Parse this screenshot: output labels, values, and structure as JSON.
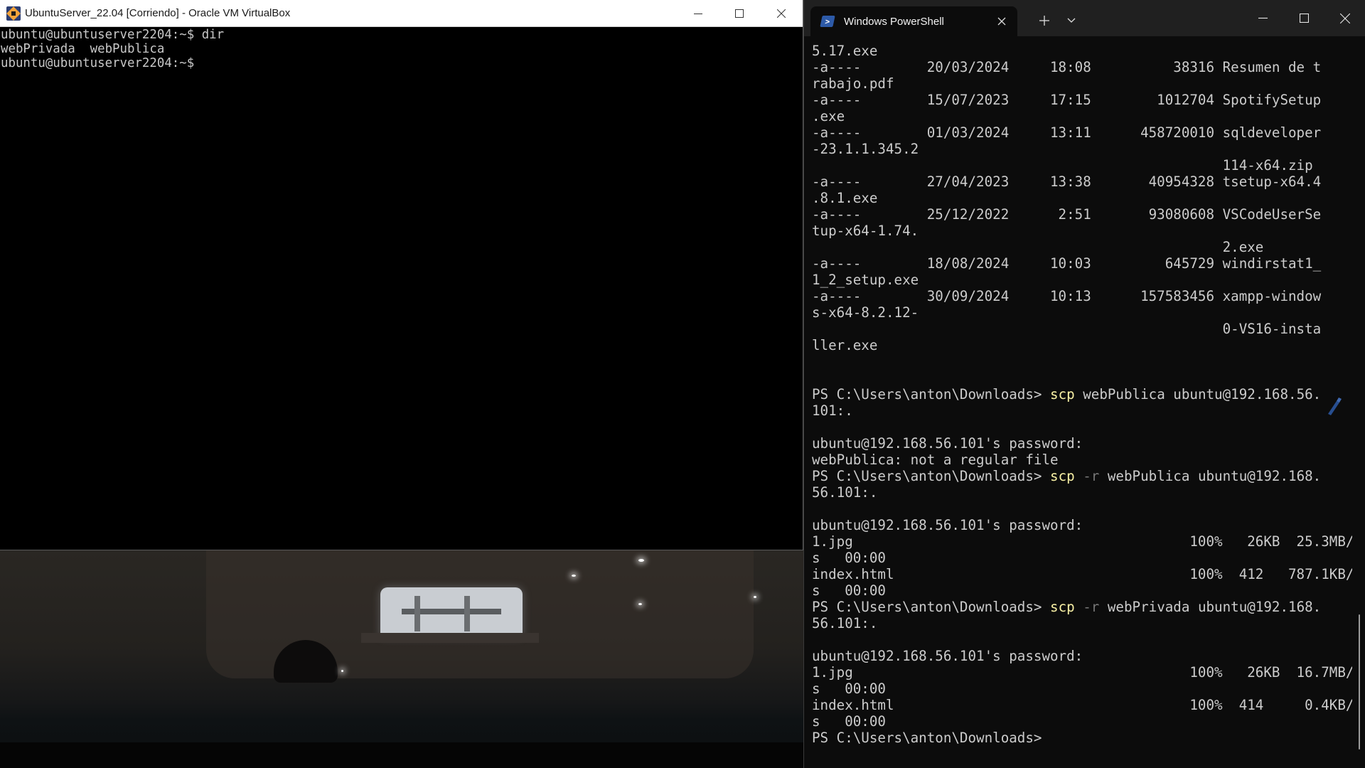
{
  "vbox": {
    "title": "UbuntuServer_22.04 [Corriendo] - Oracle VM VirtualBox",
    "icon": "virtualbox-icon",
    "console_lines": [
      "ubuntu@ubuntuserver2204:~$ dir",
      "webPrivada  webPublica",
      "ubuntu@ubuntuserver2204:~$"
    ]
  },
  "powershell": {
    "tab_title": "Windows PowerShell",
    "tab_icon": "powershell-icon",
    "prompt": "PS C:\\Users\\anton\\Downloads> ",
    "listing_lines": [
      "5.17.exe",
      "-a----        20/03/2024     18:08          38316 Resumen de t",
      "rabajo.pdf",
      "-a----        15/07/2023     17:15        1012704 SpotifySetup",
      ".exe",
      "-a----        01/03/2024     13:11      458720010 sqldeveloper",
      "-23.1.1.345.2",
      "                                                  114-x64.zip",
      "-a----        27/04/2023     13:38       40954328 tsetup-x64.4",
      ".8.1.exe",
      "-a----        25/12/2022      2:51       93080608 VSCodeUserSe",
      "tup-x64-1.74.",
      "                                                  2.exe",
      "-a----        18/08/2024     10:03         645729 windirstat1_",
      "1_2_setup.exe",
      "-a----        30/09/2024     10:13      157583456 xampp-window",
      "s-x64-8.2.12-",
      "                                                  0-VS16-insta",
      "ller.exe",
      "",
      ""
    ],
    "session1": {
      "cmd": "scp",
      "args": " webPublica ubuntu@192.168.56.",
      "wrap": "101:.",
      "output": [
        "",
        "ubuntu@192.168.56.101's password:",
        "webPublica: not a regular file"
      ]
    },
    "session2": {
      "cmd": "scp",
      "flag": " -r",
      "args": " webPublica ubuntu@192.168.",
      "wrap": "56.101:.",
      "output": [
        "",
        "ubuntu@192.168.56.101's password:",
        "1.jpg                                         100%   26KB  25.3MB/",
        "s   00:00",
        "index.html                                    100%  412   787.1KB/",
        "s   00:00"
      ]
    },
    "session3": {
      "cmd": "scp",
      "flag": " -r",
      "args": " webPrivada ubuntu@192.168.",
      "wrap": "56.101:.",
      "output": [
        "",
        "ubuntu@192.168.56.101's password:",
        "1.jpg                                         100%   26KB  16.7MB/",
        "s   00:00",
        "index.html                                    100%  414     0.4KB/",
        "s   00:00"
      ]
    }
  },
  "colors": {
    "ps_background": "#0c0c0c",
    "ps_text": "#cccccc",
    "ps_command": "#f9f1a5",
    "ps_parameter": "#767676",
    "vbox_console_text": "#c8c8c8"
  }
}
